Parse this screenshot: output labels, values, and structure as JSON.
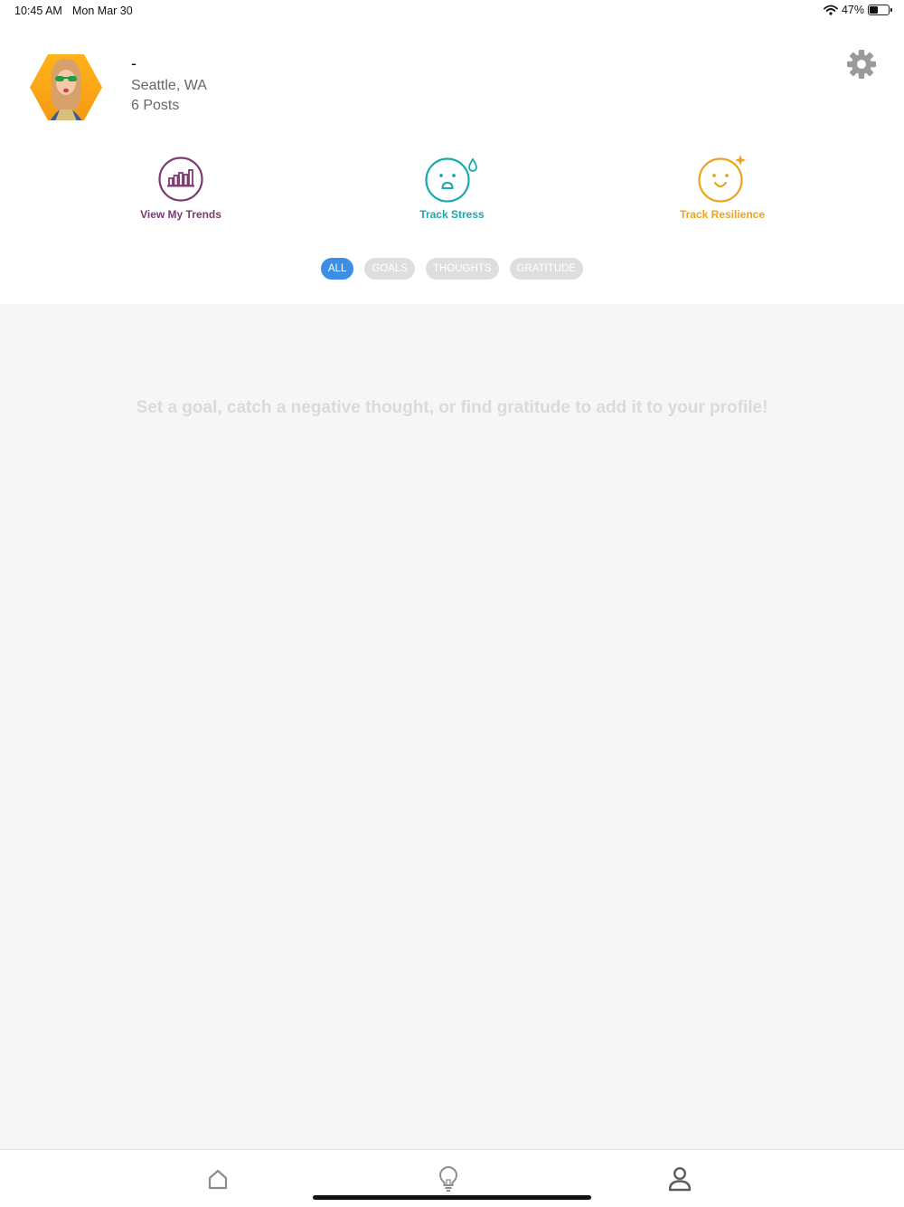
{
  "status": {
    "time": "10:45 AM",
    "date": "Mon Mar 30",
    "battery": "47%",
    "battery_level": 0.47
  },
  "profile": {
    "name": "-",
    "location": "Seattle, WA",
    "posts": "6 Posts"
  },
  "actions": [
    {
      "label": "View My Trends",
      "icon": "bar-chart-icon",
      "color": "#7b3a73"
    },
    {
      "label": "Track Stress",
      "icon": "stressed-face-icon",
      "color": "#19a9ad"
    },
    {
      "label": "Track Resilience",
      "icon": "sparkle-face-icon",
      "color": "#eba419"
    }
  ],
  "filters": [
    {
      "label": "ALL",
      "active": true
    },
    {
      "label": "GOALS",
      "active": false
    },
    {
      "label": "THOUGHTS",
      "active": false
    },
    {
      "label": "GRATITUDE",
      "active": false
    }
  ],
  "feed": {
    "empty_message": "Set a goal, catch a negative thought, or find gratitude to add it to your profile!"
  },
  "tabs": [
    {
      "icon": "home-icon",
      "selected": false
    },
    {
      "icon": "lightbulb-icon",
      "selected": false
    },
    {
      "icon": "person-icon",
      "selected": true
    }
  ],
  "colors": {
    "accent": "#3c8ee6",
    "pill_inactive": "#dedede",
    "feed_bg": "#f6f6f6"
  }
}
